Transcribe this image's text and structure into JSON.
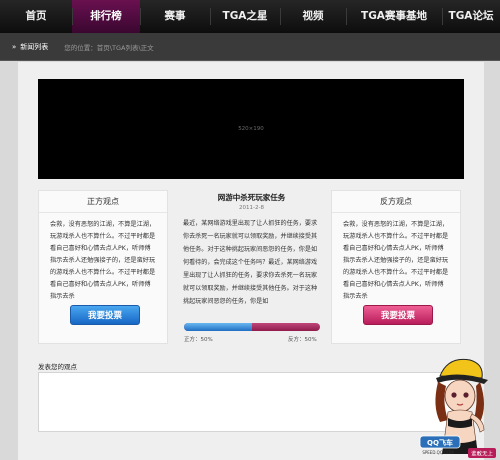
{
  "nav": {
    "items": [
      {
        "label": "首页",
        "active": false
      },
      {
        "label": "排行榜",
        "active": true
      },
      {
        "label": "赛事",
        "active": false
      },
      {
        "label": "TGA之星",
        "active": false
      },
      {
        "label": "视频",
        "active": false
      },
      {
        "label": "TGA赛事基地",
        "active": false
      },
      {
        "label": "TGA论坛",
        "active": false
      }
    ]
  },
  "subbar": {
    "section": "新闻列表",
    "breadcrumb": "您的位置：首页\\TGA列表\\正文"
  },
  "video": {
    "placeholder": "520×190"
  },
  "left_panel": {
    "title": "正方观点",
    "text": "会救，没有恶怒的江湖，不算是江湖，玩游戏杀人也不算什么。不过平时都是看自己喜好和心情去点人PK，听师傅指示去杀人还勉强接子的，还是蛮好玩的游戏杀人也不算什么。不过平时都是看自己喜好和心情去点人PK，听师傅指示去杀",
    "vote_label": "我要投票"
  },
  "right_panel": {
    "title": "反方观点",
    "text": "会救，没有恶怒的江湖，不算是江湖，玩游戏杀人也不算什么。不过平时都是看自己喜好和心情去点人PK，听师傅指示去杀人还勉强接子的，还是蛮好玩的游戏杀人也不算什么。不过平时都是看自己喜好和心情去点人PK，听师傅指示去杀",
    "vote_label": "我要投票"
  },
  "article": {
    "title": "网游中杀死玩家任务",
    "date": "2011-2-8",
    "text": "最近，某网络游戏里出现了让人抓狂的任务，要求你去杀死一名玩家就可以领取奖励，并继续接受其他任务。对于这种挑起玩家间恶怨的任务，你是如何看待的，会完成这个任务吗？最近，某网络游戏里出现了让人抓狂的任务，要求你去杀死一名玩家就可以领取奖励，并继续接受其他任务。对于这种挑起玩家间恶怨的任务，你是如"
  },
  "poll": {
    "pro_label": "正方：50%",
    "con_label": "反方：50%",
    "pro_fraction": 0.5
  },
  "opinion": {
    "label": "发表您的观点"
  },
  "brand": {
    "logo_text": "QQ飞车",
    "domain": "SPEED.QQ.COM",
    "slogan": "谁敢无上"
  }
}
